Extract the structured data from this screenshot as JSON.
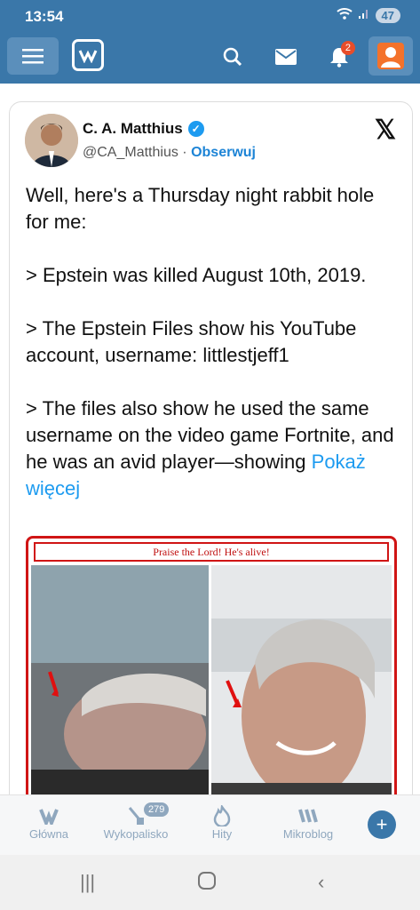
{
  "status": {
    "time": "13:54",
    "battery": "47"
  },
  "appbar": {
    "notif_count": "2"
  },
  "tweet": {
    "name": "C. A. Matthius",
    "handle": "@CA_Matthius",
    "separator": "·",
    "follow": "Obserwuj",
    "para1": "Well, here's a Thursday night rabbit hole for me:",
    "para2": "> Epstein was killed August 10th, 2019.",
    "para3": "> The Epstein Files show his YouTube account, username: littlestjeff1",
    "para4": "> The files also show he used the same username on the video game Fortnite, and he was an avid player—showing",
    "more": "Pokaż więcej",
    "image_caption": "Praise the Lord!  He's alive!"
  },
  "bottom_nav": {
    "items": [
      {
        "label": "Główna"
      },
      {
        "label": "Wykopalisko",
        "badge": "279"
      },
      {
        "label": "Hity"
      },
      {
        "label": "Mikroblog"
      }
    ]
  },
  "colors": {
    "brand": "#3a77a9",
    "link": "#1d9bf0",
    "badge": "#e84d2a"
  }
}
